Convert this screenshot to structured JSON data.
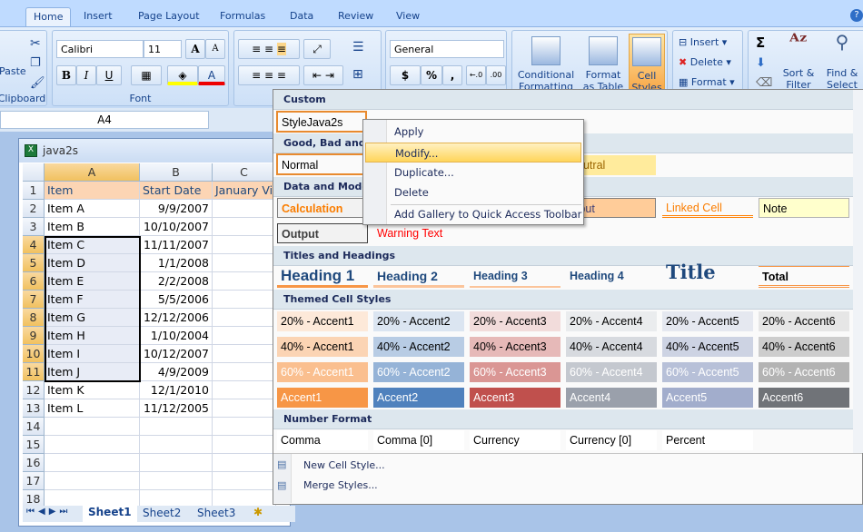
{
  "ribbon": {
    "tabs": [
      "Home",
      "Insert",
      "Page Layout",
      "Formulas",
      "Data",
      "Review",
      "View"
    ],
    "active_tab": "Home",
    "clipboard": {
      "paste": "Paste",
      "label": "Clipboard"
    },
    "font": {
      "name": "Calibri",
      "size": "11",
      "label": "Font",
      "bold": "B",
      "italic": "I",
      "underline": "U",
      "grow": "A",
      "shrink": "A"
    },
    "number": {
      "format": "General",
      "currency": "$",
      "percent": "%",
      "comma": ",",
      "inc": "←.0",
      "dec": ".00"
    },
    "styles": {
      "conditional": "Conditional Formatting",
      "format_table": "Format as Table",
      "cell_styles": "Cell Styles"
    },
    "cells": {
      "insert": "Insert",
      "delete": "Delete",
      "format": "Format"
    },
    "editing": {
      "sum": "Σ",
      "sort": "Sort & Filter",
      "find": "Find & Select"
    }
  },
  "formula_bar": {
    "name_box": "A4"
  },
  "workbook": {
    "title": "java2s",
    "columns": [
      "A",
      "B",
      "C"
    ],
    "rows": [
      [
        "1",
        "Item",
        "Start Date",
        "January Vi"
      ],
      [
        "2",
        "Item A",
        "9/9/2007",
        ""
      ],
      [
        "3",
        "Item B",
        "10/10/2007",
        ""
      ],
      [
        "4",
        "Item C",
        "11/11/2007",
        ""
      ],
      [
        "5",
        "Item D",
        "1/1/2008",
        ""
      ],
      [
        "6",
        "Item E",
        "2/2/2008",
        ""
      ],
      [
        "7",
        "Item F",
        "5/5/2006",
        ""
      ],
      [
        "8",
        "Item G",
        "12/12/2006",
        ""
      ],
      [
        "9",
        "Item H",
        "1/10/2004",
        ""
      ],
      [
        "10",
        "Item I",
        "10/12/2007",
        ""
      ],
      [
        "11",
        "Item J",
        "4/9/2009",
        ""
      ],
      [
        "12",
        "Item K",
        "12/1/2010",
        ""
      ],
      [
        "13",
        "Item L",
        "11/12/2005",
        ""
      ],
      [
        "14",
        "",
        "",
        ""
      ],
      [
        "15",
        "",
        "",
        ""
      ],
      [
        "16",
        "",
        "",
        ""
      ],
      [
        "17",
        "",
        "",
        ""
      ],
      [
        "18",
        "",
        "",
        ""
      ]
    ],
    "sheets": [
      "Sheet1",
      "Sheet2",
      "Sheet3"
    ],
    "active_sheet": "Sheet1"
  },
  "gallery": {
    "sections": {
      "custom": "Custom",
      "good": "Good, Bad and Neutral",
      "data": "Data and Model",
      "titles": "Titles and Headings",
      "themed": "Themed Cell Styles",
      "number": "Number Format"
    },
    "custom": [
      "StyleJava2s"
    ],
    "good": [
      "Normal",
      "Neutral"
    ],
    "data": [
      "Calculation",
      "Input",
      "Linked Cell",
      "Note",
      "Output",
      "Warning Text"
    ],
    "titles": [
      "Heading 1",
      "Heading 2",
      "Heading 3",
      "Heading 4",
      "Title",
      "Total"
    ],
    "themed": [
      [
        "20% - Accent1",
        "20% - Accent2",
        "20% - Accent3",
        "20% - Accent4",
        "20% - Accent5",
        "20% - Accent6"
      ],
      [
        "40% - Accent1",
        "40% - Accent2",
        "40% - Accent3",
        "40% - Accent4",
        "40% - Accent5",
        "40% - Accent6"
      ],
      [
        "60% - Accent1",
        "60% - Accent2",
        "60% - Accent3",
        "60% - Accent4",
        "60% - Accent5",
        "60% - Accent6"
      ],
      [
        "Accent1",
        "Accent2",
        "Accent3",
        "Accent4",
        "Accent5",
        "Accent6"
      ]
    ],
    "themed_colors": [
      [
        "#fde9d9",
        "#dbe5f1",
        "#f2dcdb",
        "#eaecee",
        "#e5e8f0",
        "#e6e6e6"
      ],
      [
        "#fbd4b4",
        "#b8cce4",
        "#e6b9b8",
        "#d7dadf",
        "#cdd3e3",
        "#cdcdcd"
      ],
      [
        "#fabf8f",
        "#95b3d7",
        "#da9694",
        "#c4c8cf",
        "#b7c0d8",
        "#b3b3b3"
      ],
      [
        "#f79646",
        "#4f81bd",
        "#c0504d",
        "#9aa0ab",
        "#a2adcc",
        "#707378"
      ]
    ],
    "number": [
      "Comma",
      "Comma [0]",
      "Currency",
      "Currency [0]",
      "Percent"
    ],
    "footer": [
      "New Cell Style...",
      "Merge Styles..."
    ]
  },
  "context_menu": {
    "items": [
      "Apply",
      "Modify...",
      "Duplicate...",
      "Delete",
      "Add Gallery to Quick Access Toolbar"
    ],
    "highlighted": "Modify..."
  }
}
